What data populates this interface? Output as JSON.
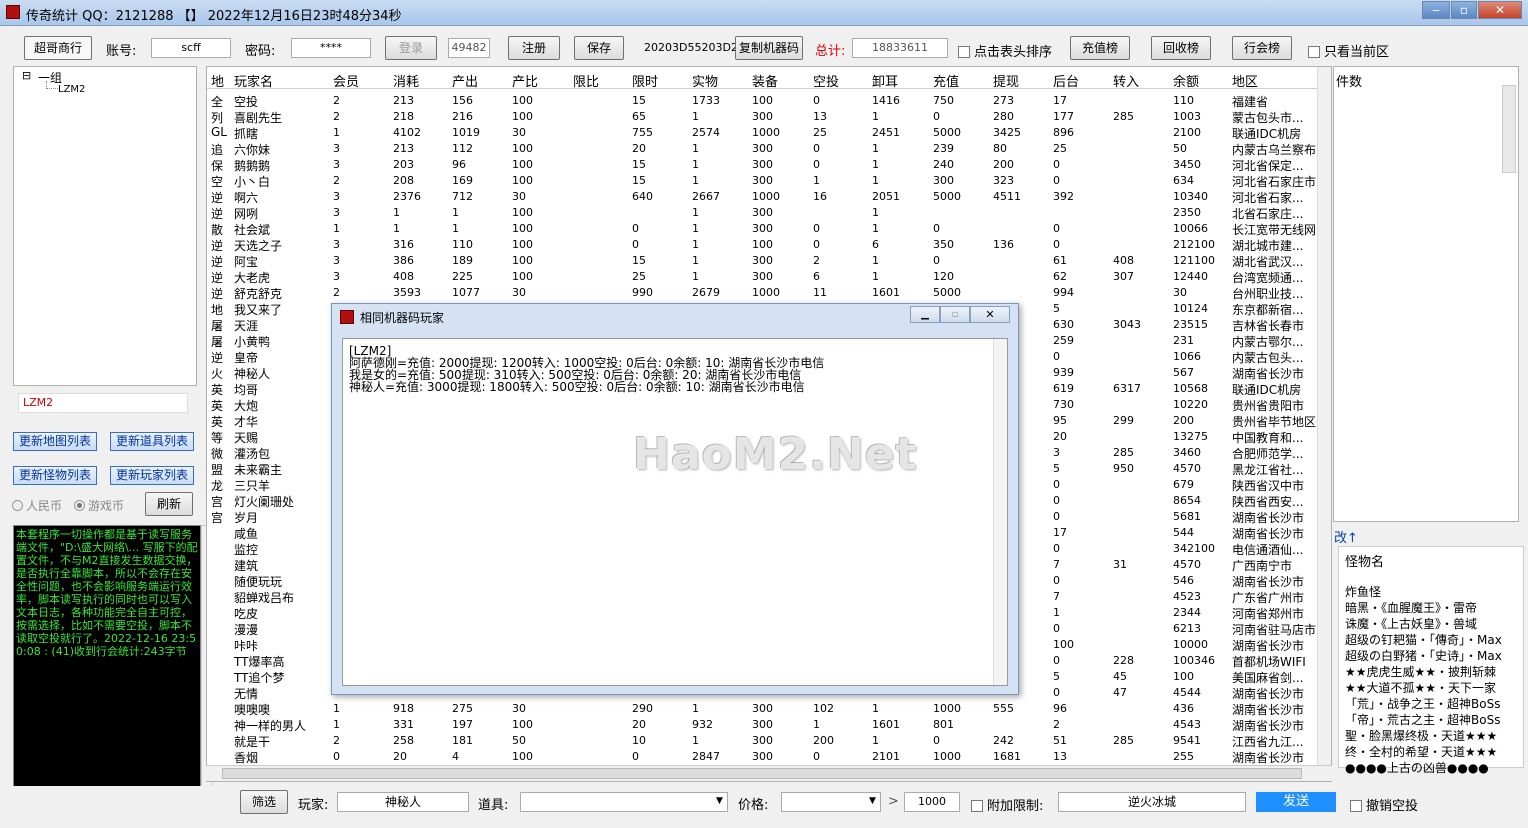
{
  "window": {
    "title": "传奇统计 QQ：2121288 【】 2022年12月16日23时48分34秒",
    "minimize": "‒",
    "maximize": "▫",
    "close": "✕"
  },
  "toolbar": {
    "mode_button": "超哥商行",
    "account_label": "账号:",
    "account_value": "scff",
    "password_label": "密码:",
    "password_value": "****",
    "login_button": "登录",
    "port_value": "49482",
    "register_button": "注册",
    "save_button": "保存",
    "machine_code": "20203D55203D2",
    "copy_machine_button": "复制机器码",
    "total_label": "总计:",
    "total_value": "18833611",
    "sort_checkbox_label": "点击表头排序",
    "recharge_rank_button": "充值榜",
    "recycle_rank_button": "回收榜",
    "guild_rank_button": "行会榜",
    "current_zone_checkbox_label": "只看当前区"
  },
  "tree": {
    "group_label": "一组",
    "child_label": "LZM2",
    "toggle": "⊟"
  },
  "left_panel": {
    "selected_server": "LZM2",
    "update_map_button": "更新地图列表",
    "update_item_button": "更新道具列表",
    "update_monster_button": "更新怪物列表",
    "update_player_button": "更新玩家列表",
    "rmb_radio": "人民币",
    "game_coin_radio": "游戏币",
    "refresh_button": "刷新",
    "console_text": "本套程序一切操作都是基于读写服务端文件，\"D:\\盛大网络\\... 写服下的配置文件，不与M2直接发生数据交换，是否执行全靠脚本，所以不会存在安全性问题，也不会影响服务端运行效率，脚本读写执行的同时也可以写入文本日志，各种功能完全自主可控，按需选择，比如不需要空投，脚本不读取空投就行了。2022-12-16 23:50:08 : (41)收到行会统计:243字节"
  },
  "table": {
    "map_col_header": "地",
    "map_col_values": [
      "全",
      "列",
      "GL",
      "追",
      "保",
      "空",
      "逆",
      "逆",
      "散",
      "逆",
      "逆",
      "逆",
      "逆",
      "地",
      "屠",
      "屠",
      "逆",
      "火",
      "英",
      "英",
      "英",
      "等",
      "微",
      "盟",
      "龙",
      "宫",
      "宫"
    ],
    "headers": [
      "玩家名",
      "会员",
      "消耗",
      "产出",
      "产比",
      "限比",
      "限时",
      "实物",
      "装备",
      "空投",
      "卸耳",
      "充值",
      "提现",
      "后台",
      "转入",
      "余额",
      "地区"
    ],
    "rows": [
      [
        "空投",
        "2",
        "213",
        "156",
        "100",
        "",
        "15",
        "1733",
        "100",
        "0",
        "1416",
        "750",
        "273",
        "17",
        "",
        "110",
        "福建省"
      ],
      [
        "喜剧先生",
        "2",
        "218",
        "216",
        "100",
        "",
        "65",
        "1",
        "300",
        "13",
        "1",
        "0",
        "280",
        "177",
        "285",
        "1003",
        "蒙古包头市..."
      ],
      [
        "抓瞎",
        "1",
        "4102",
        "1019",
        "30",
        "",
        "755",
        "2574",
        "1000",
        "25",
        "2451",
        "5000",
        "3425",
        "896",
        "",
        "2100",
        "联通IDC机房"
      ],
      [
        "六你妹",
        "3",
        "213",
        "112",
        "100",
        "",
        "20",
        "1",
        "300",
        "0",
        "1",
        "239",
        "80",
        "25",
        "",
        "50",
        "内蒙古乌兰察布"
      ],
      [
        "鹅鹅鹅",
        "3",
        "203",
        "96",
        "100",
        "",
        "15",
        "1",
        "300",
        "0",
        "1",
        "240",
        "200",
        "0",
        "",
        "3450",
        "河北省保定..."
      ],
      [
        "小丶白",
        "2",
        "208",
        "169",
        "100",
        "",
        "15",
        "1",
        "300",
        "1",
        "1",
        "300",
        "323",
        "0",
        "",
        "634",
        "河北省石家庄市"
      ],
      [
        "啊六",
        "3",
        "2376",
        "712",
        "30",
        "",
        "640",
        "2667",
        "1000",
        "16",
        "2051",
        "5000",
        "4511",
        "392",
        "",
        "10340",
        "河北省石家..."
      ],
      [
        "网咧",
        "3",
        "1",
        "1",
        "100",
        "",
        "",
        "1",
        "300",
        "",
        "1",
        "",
        "",
        "",
        "",
        "2350",
        "北省石家庄..."
      ],
      [
        "社会斌",
        "1",
        "1",
        "1",
        "100",
        "",
        "0",
        "1",
        "300",
        "0",
        "1",
        "0",
        "",
        "0",
        "",
        "10066",
        "长江宽带无线网"
      ],
      [
        "天选之子",
        "3",
        "316",
        "110",
        "100",
        "",
        "0",
        "1",
        "100",
        "0",
        "6",
        "350",
        "136",
        "0",
        "",
        "212100",
        "湖北城市建..."
      ],
      [
        "阿宝",
        "3",
        "386",
        "189",
        "100",
        "",
        "15",
        "1",
        "300",
        "2",
        "1",
        "0",
        "",
        "61",
        "408",
        "121100",
        "湖北省武汉..."
      ],
      [
        "大老虎",
        "3",
        "408",
        "225",
        "100",
        "",
        "25",
        "1",
        "300",
        "6",
        "1",
        "120",
        "",
        "62",
        "307",
        "12440",
        "台湾宽频通..."
      ],
      [
        "舒克舒克",
        "2",
        "3593",
        "1077",
        "30",
        "",
        "990",
        "2679",
        "1000",
        "11",
        "1601",
        "5000",
        "",
        "994",
        "",
        "30",
        "台州职业技..."
      ],
      [
        "我又来了",
        "",
        "",
        "",
        "",
        "",
        "",
        "",
        "",
        "",
        "",
        "",
        "",
        "5",
        "",
        "10124",
        "东京都新宿..."
      ],
      [
        "天涯",
        "",
        "",
        "",
        "",
        "",
        "",
        "",
        "",
        "",
        "",
        "",
        "",
        "630",
        "3043",
        "23515",
        "吉林省长春市"
      ],
      [
        "小黄鸭",
        "",
        "",
        "",
        "",
        "",
        "",
        "",
        "",
        "",
        "",
        "",
        "",
        "259",
        "",
        "231",
        "内蒙古鄂尔..."
      ],
      [
        "皇帝",
        "",
        "",
        "",
        "",
        "",
        "",
        "",
        "",
        "",
        "",
        "",
        "",
        "0",
        "",
        "1066",
        "内蒙古包头..."
      ],
      [
        "神秘人",
        "",
        "",
        "",
        "",
        "",
        "",
        "",
        "",
        "",
        "",
        "",
        "",
        "939",
        "",
        "567",
        "湖南省长沙市"
      ],
      [
        "均哥",
        "",
        "",
        "",
        "",
        "",
        "",
        "",
        "",
        "",
        "",
        "",
        "",
        "619",
        "6317",
        "10568",
        "联通IDC机房"
      ],
      [
        "大炮",
        "",
        "",
        "",
        "",
        "",
        "",
        "",
        "",
        "",
        "",
        "",
        "",
        "730",
        "",
        "10220",
        "贵州省贵阳市"
      ],
      [
        "才华",
        "",
        "",
        "",
        "",
        "",
        "",
        "",
        "",
        "",
        "",
        "",
        "",
        "95",
        "299",
        "200",
        "贵州省毕节地区"
      ],
      [
        "天赐",
        "",
        "",
        "",
        "",
        "",
        "",
        "",
        "",
        "",
        "",
        "",
        "",
        "20",
        "",
        "13275",
        "中国教育和..."
      ],
      [
        "灌汤包",
        "",
        "",
        "",
        "",
        "",
        "",
        "",
        "",
        "",
        "",
        "",
        "",
        "3",
        "285",
        "3460",
        "合肥师范学..."
      ],
      [
        "未来霸主",
        "",
        "",
        "",
        "",
        "",
        "",
        "",
        "",
        "",
        "",
        "",
        "",
        "5",
        "950",
        "4570",
        "黑龙江省社..."
      ],
      [
        "三只羊",
        "",
        "",
        "",
        "",
        "",
        "",
        "",
        "",
        "",
        "",
        "",
        "",
        "0",
        "",
        "679",
        "陕西省汉中市"
      ],
      [
        "灯火阑珊处",
        "",
        "",
        "",
        "",
        "",
        "",
        "",
        "",
        "",
        "",
        "",
        "",
        "0",
        "",
        "8654",
        "陕西省西安..."
      ],
      [
        "岁月",
        "",
        "",
        "",
        "",
        "",
        "",
        "",
        "",
        "",
        "",
        "",
        "",
        "0",
        "",
        "5681",
        "湖南省长沙市"
      ],
      [
        "咸鱼",
        "",
        "",
        "",
        "",
        "",
        "",
        "",
        "",
        "",
        "",
        "",
        "",
        "17",
        "",
        "544",
        "湖南省长沙市"
      ],
      [
        "监控",
        "",
        "",
        "",
        "",
        "",
        "",
        "",
        "",
        "",
        "",
        "",
        "",
        "0",
        "",
        "342100",
        "电信通酒仙..."
      ],
      [
        "建筑",
        "",
        "",
        "",
        "",
        "",
        "",
        "",
        "",
        "",
        "",
        "",
        "",
        "7",
        "31",
        "4570",
        "广西南宁市"
      ],
      [
        "随便玩玩",
        "",
        "",
        "",
        "",
        "",
        "",
        "",
        "",
        "",
        "",
        "",
        "",
        "0",
        "",
        "546",
        "湖南省长沙市"
      ],
      [
        "貂蝉戏吕布",
        "",
        "",
        "",
        "",
        "",
        "",
        "",
        "",
        "",
        "",
        "",
        "",
        "7",
        "",
        "4523",
        "广东省广州市"
      ],
      [
        "吃皮",
        "",
        "",
        "",
        "",
        "",
        "",
        "",
        "",
        "",
        "",
        "",
        "",
        "1",
        "",
        "2344",
        "河南省郑州市"
      ],
      [
        "漫漫",
        "",
        "",
        "",
        "",
        "",
        "",
        "",
        "",
        "",
        "",
        "",
        "",
        "0",
        "",
        "6213",
        "河南省驻马店市"
      ],
      [
        "咔咔",
        "",
        "",
        "",
        "",
        "",
        "",
        "",
        "",
        "",
        "",
        "",
        "",
        "100",
        "",
        "10000",
        "湖南省长沙市"
      ],
      [
        "TT爆率高",
        "",
        "",
        "",
        "",
        "",
        "",
        "",
        "",
        "",
        "",
        "",
        "",
        "0",
        "228",
        "100346",
        "首都机场WIFI"
      ],
      [
        "TT追个梦",
        "",
        "",
        "",
        "",
        "",
        "",
        "",
        "",
        "",
        "",
        "",
        "",
        "5",
        "45",
        "100",
        "美国麻省剑..."
      ],
      [
        "无情",
        "",
        "",
        "",
        "",
        "",
        "",
        "",
        "",
        "",
        "",
        "",
        "",
        "0",
        "47",
        "4544",
        "湖南省长沙市"
      ],
      [
        "噢噢噢",
        "1",
        "918",
        "275",
        "30",
        "",
        "290",
        "1",
        "300",
        "102",
        "1",
        "1000",
        "555",
        "96",
        "",
        "436",
        "湖南省长沙市"
      ],
      [
        "神一样的男人",
        "1",
        "331",
        "197",
        "100",
        "",
        "20",
        "932",
        "300",
        "1",
        "1601",
        "801",
        "",
        "2",
        "",
        "4543",
        "湖南省长沙市"
      ],
      [
        "就是干",
        "2",
        "258",
        "181",
        "50",
        "",
        "10",
        "1",
        "300",
        "200",
        "1",
        "0",
        "242",
        "51",
        "285",
        "9541",
        "江西省九江..."
      ],
      [
        "香烟",
        "0",
        "20",
        "4",
        "100",
        "",
        "0",
        "2847",
        "300",
        "0",
        "2101",
        "1000",
        "1681",
        "13",
        "",
        "255",
        "湖南省长沙市"
      ]
    ]
  },
  "right_panel": {
    "header": "件数",
    "link": "改↑"
  },
  "monster_list": {
    "header": "怪物名",
    "items": [
      "炸鱼怪",
      "暗黑・《血腥魔王》・雷帝",
      "诛魔・《上古妖皇》・兽域",
      "超级の钉耙猫・「傳奇」・Max",
      "超级の白野猪・「史诗」・Max",
      "★★虎虎生威★★・披荆斩棘",
      "★★大道不孤★★・天下一家",
      "「荒」・战争之王・超神BoSs",
      "「帝」・荒古之主・超神BoSs",
      "聖・脸黑爆终极・天道★★★",
      "终・全村的希望・天道★★★",
      "●●●●上古の凶兽●●●●"
    ]
  },
  "bottom": {
    "filter_button": "筛选",
    "player_label": "玩家:",
    "player_value": "神秘人",
    "item_label": "道具:",
    "item_value": "",
    "price_label": "价格:",
    "price_value": "",
    "price_op": ">",
    "price_amount": "1000",
    "extra_limit_label": "附加限制:",
    "extra_value": "逆火冰城",
    "send_button": "发送",
    "cancel_airdrop_label": "撤销空投"
  },
  "dialog": {
    "title": "相同机器码玩家",
    "lines": [
      "[LZM2]",
      "阿萨德刚=充值: 2000提现: 1200转入: 1000空投: 0后台: 0余额: 10: 湖南省长沙市电信",
      "我是女的=充值: 500提现: 310转入: 500空投: 0后台: 0余额: 20: 湖南省长沙市电信",
      "神秘人=充值: 3000提现: 1800转入: 500空投: 0后台: 0余额: 10: 湖南省长沙市电信"
    ],
    "watermark": "HaoM2.Net"
  }
}
